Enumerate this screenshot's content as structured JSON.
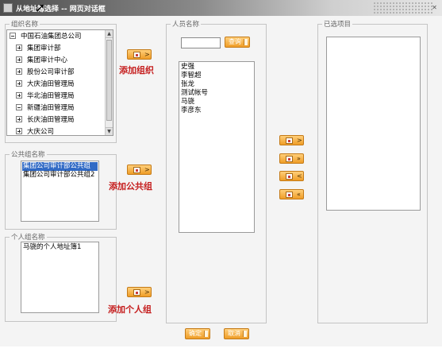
{
  "window": {
    "title": "从地址簿选择 -- 网页对话框"
  },
  "panels": {
    "org": {
      "legend": "组织名称"
    },
    "public": {
      "legend": "公共组名称"
    },
    "personal": {
      "legend": "个人组名称"
    },
    "people": {
      "legend": "人员名称"
    },
    "selected": {
      "legend": "已选项目"
    }
  },
  "org_tree": [
    {
      "label": "中国石油集团总公司",
      "expander": "minus"
    },
    {
      "label": "集团审计部",
      "expander": "plus"
    },
    {
      "label": "集团审计中心",
      "expander": "plus"
    },
    {
      "label": "股份公司审计部",
      "expander": "plus"
    },
    {
      "label": "大庆油田管理局",
      "expander": "plus"
    },
    {
      "label": "华北油田管理局",
      "expander": "plus"
    },
    {
      "label": "新疆油田管理局",
      "expander": "minus"
    },
    {
      "label": "长庆油田管理局",
      "expander": "plus"
    },
    {
      "label": "大庆公司",
      "expander": "plus"
    }
  ],
  "public_groups": [
    "集团公司审计部公共组",
    "集团公司审计部公共组2"
  ],
  "personal_groups": [
    "马骁的个人地址簿1"
  ],
  "people": [
    "史强",
    "李智超",
    "张龙",
    "测试帐号",
    "马骁",
    "李彦东"
  ],
  "labels": {
    "add_org": "添加组织",
    "add_public": "添加公共组",
    "add_personal": "添加个人组"
  },
  "buttons": {
    "search": "查询",
    "ok": "确定",
    "cancel": "取消"
  },
  "icons": {
    "add_org": "add-icon",
    "add_public": "add-icon",
    "add_personal": "add-icon",
    "move_one_right": "user-add-icon",
    "move_all_right": "users-add-all-icon",
    "move_one_left": "user-remove-icon",
    "move_all_left": "users-remove-all-icon"
  }
}
